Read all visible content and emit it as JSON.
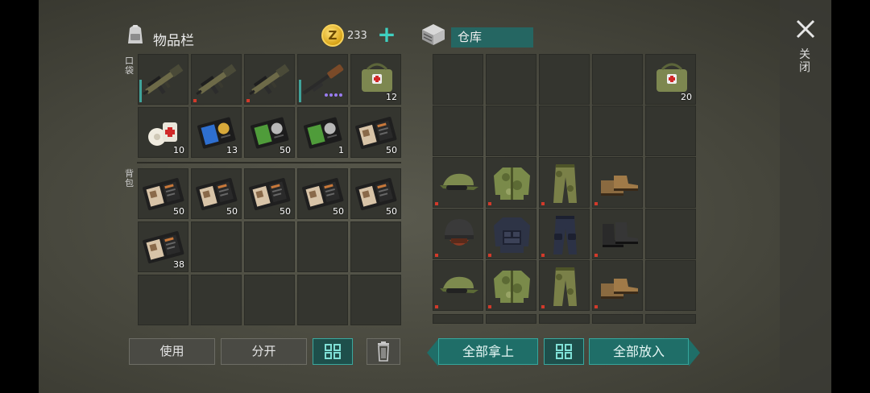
{
  "inventory": {
    "title": "物品栏",
    "coin_symbol": "Z",
    "coins": "233",
    "add_label": "+",
    "pocket_label": "口袋",
    "backpack_label": "背包"
  },
  "warehouse": {
    "title": "仓库"
  },
  "close_label": "关闭",
  "buttons": {
    "use": "使用",
    "split": "分开",
    "take_all": "全部拿上",
    "put_all": "全部放入"
  },
  "pocket_slots": [
    {
      "item": "rifle",
      "count": ""
    },
    {
      "item": "rifle",
      "count": ""
    },
    {
      "item": "rifle",
      "count": ""
    },
    {
      "item": "shotgun",
      "count": ""
    },
    {
      "item": "medkit-bag",
      "count": "12"
    },
    {
      "item": "bandage",
      "count": "10"
    },
    {
      "item": "blue-id-card",
      "count": "13"
    },
    {
      "item": "green-id-card",
      "count": "50"
    },
    {
      "item": "green-id-card",
      "count": "1"
    },
    {
      "item": "notebook",
      "count": "50"
    }
  ],
  "backpack_slots": [
    {
      "item": "notebook",
      "count": "50"
    },
    {
      "item": "notebook",
      "count": "50"
    },
    {
      "item": "notebook",
      "count": "50"
    },
    {
      "item": "notebook",
      "count": "50"
    },
    {
      "item": "notebook",
      "count": "50"
    },
    {
      "item": "notebook",
      "count": "38"
    }
  ],
  "warehouse_slots": [
    {
      "item": "",
      "count": ""
    },
    {
      "item": "",
      "count": ""
    },
    {
      "item": "",
      "count": ""
    },
    {
      "item": "",
      "count": ""
    },
    {
      "item": "medkit-bag",
      "count": "20"
    },
    {
      "item": "",
      "count": ""
    },
    {
      "item": "",
      "count": ""
    },
    {
      "item": "",
      "count": ""
    },
    {
      "item": "",
      "count": ""
    },
    {
      "item": "",
      "count": ""
    },
    {
      "item": "camo-cap",
      "count": ""
    },
    {
      "item": "camo-jacket",
      "count": ""
    },
    {
      "item": "camo-pants",
      "count": ""
    },
    {
      "item": "tan-boots",
      "count": ""
    },
    {
      "item": "",
      "count": ""
    },
    {
      "item": "black-helmet",
      "count": ""
    },
    {
      "item": "tactical-vest",
      "count": ""
    },
    {
      "item": "tactical-pants",
      "count": ""
    },
    {
      "item": "black-boots",
      "count": ""
    },
    {
      "item": "",
      "count": ""
    },
    {
      "item": "camo-cap",
      "count": ""
    },
    {
      "item": "camo-jacket",
      "count": ""
    },
    {
      "item": "camo-pants",
      "count": ""
    },
    {
      "item": "tan-boots",
      "count": ""
    },
    {
      "item": "",
      "count": ""
    }
  ],
  "colors": {
    "accent": "#1f6e68",
    "accent_border": "#35a69c",
    "slot": "#34352f"
  }
}
